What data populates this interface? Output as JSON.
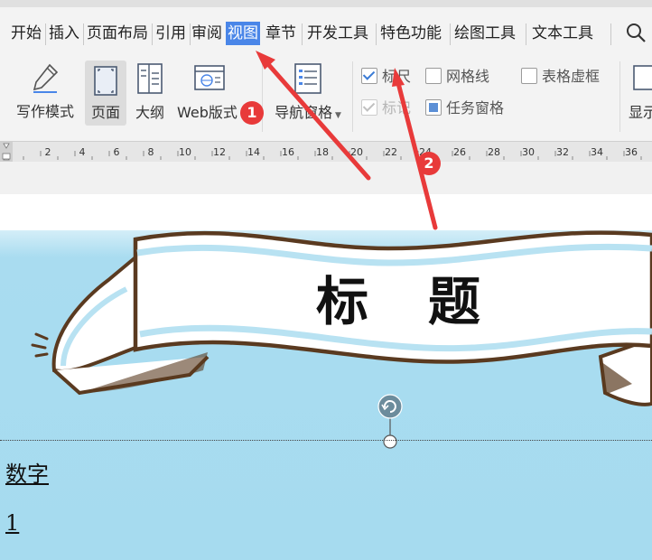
{
  "menu": {
    "items": [
      "开始",
      "插入",
      "页面布局",
      "引用",
      "审阅",
      "视图",
      "章节",
      "开发工具",
      "特色功能",
      "绘图工具",
      "文本工具"
    ],
    "active": "视图"
  },
  "toolbar": {
    "write_mode": "写作模式",
    "page": "页面",
    "outline": "大纲",
    "web": "Web版式",
    "nav_pane": "导航窗格",
    "ruler": "标尺",
    "gridlines": "网格线",
    "table_gridlines": "表格虚框",
    "marks": "标记",
    "task_pane": "任务窗格",
    "display": "显示"
  },
  "ruler": {
    "ticks": [
      "2",
      "4",
      "6",
      "8",
      "10",
      "12",
      "14",
      "16",
      "18",
      "20",
      "22",
      "24",
      "26",
      "28",
      "30",
      "32",
      "34",
      "36"
    ]
  },
  "document": {
    "banner_title": "标题",
    "field_label": "数字",
    "field_value": "1"
  },
  "annotations": {
    "step1": "1",
    "step2": "2"
  },
  "colors": {
    "active_tab": "#4a86e8",
    "annotation": "#e83a3a",
    "sky": "#a6dbef"
  }
}
